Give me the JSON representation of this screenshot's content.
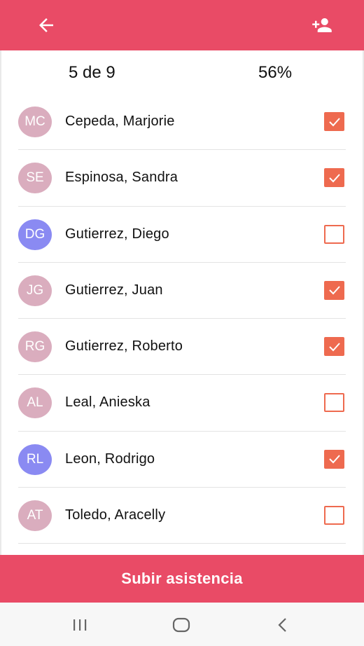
{
  "header": {
    "back_icon": "arrow-left-icon",
    "add_icon": "person-add-icon",
    "color": "#e94b66"
  },
  "summary": {
    "count": "5 de 9",
    "percent": "56%"
  },
  "students": [
    {
      "initials": "MC",
      "name": "Cepeda, Marjorie",
      "checked": true,
      "avatar_color": "#d9a9bb"
    },
    {
      "initials": "SE",
      "name": "Espinosa, Sandra",
      "checked": true,
      "avatar_color": "#d9a9bb"
    },
    {
      "initials": "DG",
      "name": "Gutierrez, Diego",
      "checked": false,
      "avatar_color": "#8484f2"
    },
    {
      "initials": "JG",
      "name": "Gutierrez, Juan",
      "checked": true,
      "avatar_color": "#d9a9bb"
    },
    {
      "initials": "RG",
      "name": "Gutierrez, Roberto",
      "checked": true,
      "avatar_color": "#d9a9bb"
    },
    {
      "initials": "AL",
      "name": "Leal, Anieska",
      "checked": false,
      "avatar_color": "#d9a9bb"
    },
    {
      "initials": "RL",
      "name": "Leon, Rodrigo",
      "checked": true,
      "avatar_color": "#8484f2"
    },
    {
      "initials": "AT",
      "name": "Toledo, Aracelly",
      "checked": false,
      "avatar_color": "#d9a9bb"
    }
  ],
  "submit": {
    "label": "Subir asistencia"
  },
  "navbar": {
    "recents_icon": "recent-apps-icon",
    "home_icon": "home-icon",
    "back_icon": "system-back-icon"
  },
  "colors": {
    "accent": "#e94b66",
    "checkbox": "#ee6a4f"
  }
}
